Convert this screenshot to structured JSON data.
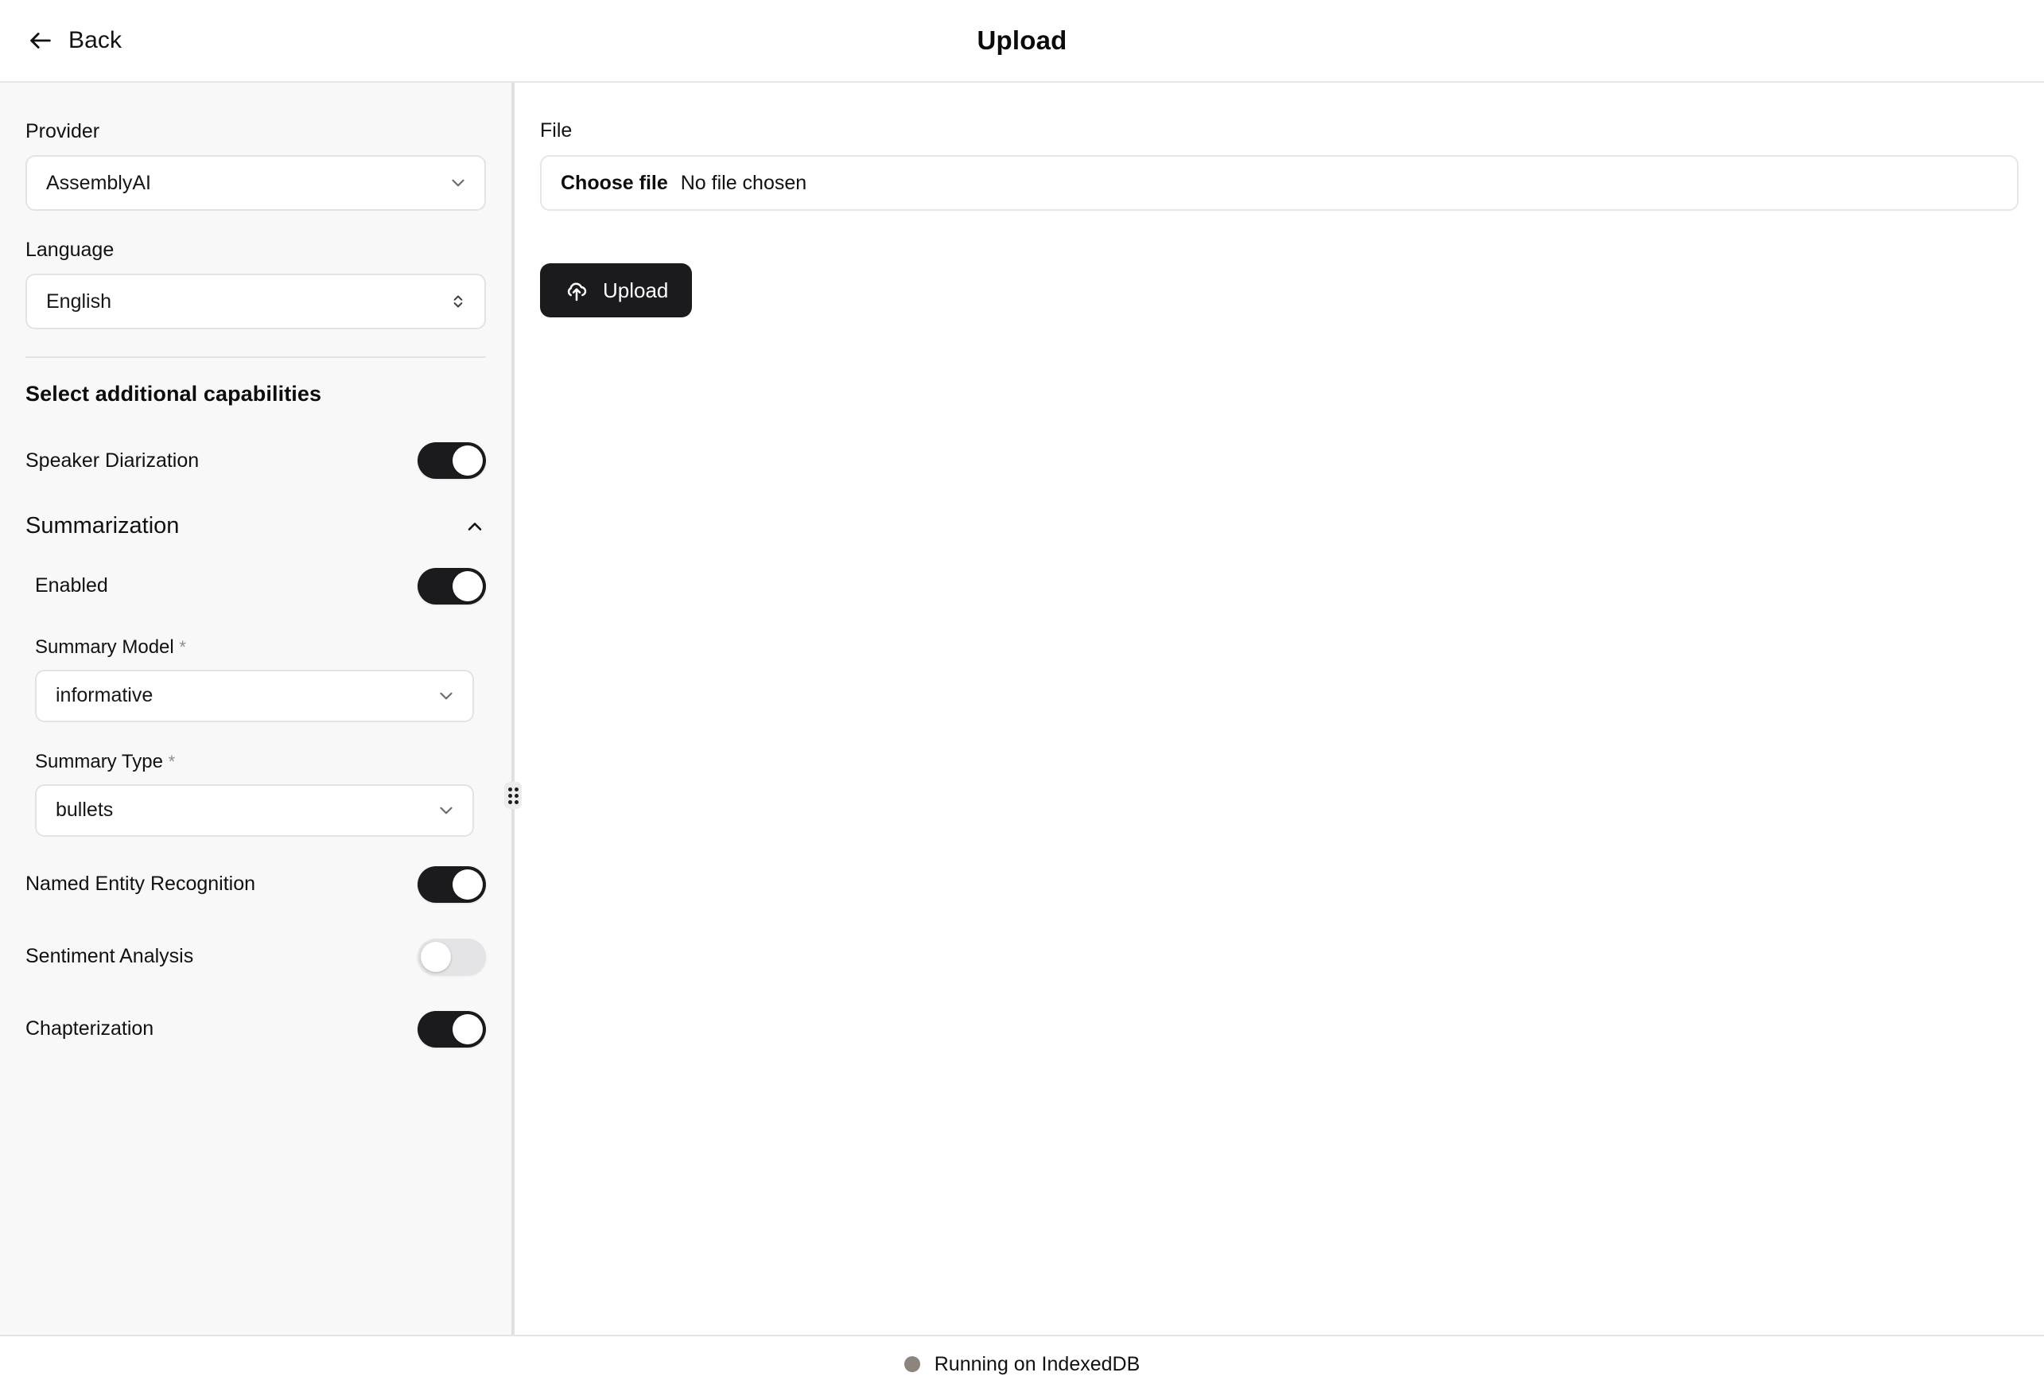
{
  "header": {
    "back_label": "Back",
    "title": "Upload"
  },
  "sidebar": {
    "provider": {
      "label": "Provider",
      "value": "AssemblyAI"
    },
    "language": {
      "label": "Language",
      "value": "English"
    },
    "capabilities_heading": "Select additional capabilities",
    "speaker_diarization": {
      "label": "Speaker Diarization",
      "state": "on"
    },
    "summarization": {
      "title": "Summarization",
      "collapse_state": "expanded",
      "enabled": {
        "label": "Enabled",
        "state": "on"
      },
      "summary_model": {
        "label": "Summary Model",
        "required_marker": "*",
        "value": "informative"
      },
      "summary_type": {
        "label": "Summary Type",
        "required_marker": "*",
        "value": "bullets"
      }
    },
    "named_entity_recognition": {
      "label": "Named Entity Recognition",
      "state": "on"
    },
    "sentiment_analysis": {
      "label": "Sentiment Analysis",
      "state": "off"
    },
    "chapterization": {
      "label": "Chapterization",
      "state": "on"
    }
  },
  "main": {
    "file_label": "File",
    "file_input": {
      "button_label": "Choose file",
      "status_text": "No file chosen"
    },
    "upload_button": {
      "label": "Upload"
    }
  },
  "footer": {
    "status_text": "Running on IndexedDB",
    "status_color": "#8d847c"
  },
  "colors": {
    "accent": "#1b1b1d",
    "sidebar_bg": "#f8f8f8",
    "border": "#e4e4e4"
  }
}
